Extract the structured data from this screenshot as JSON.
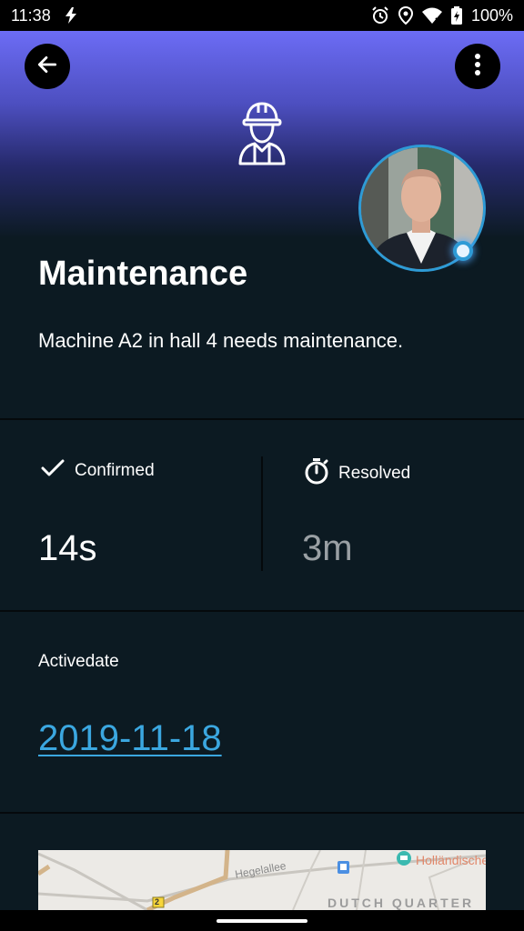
{
  "status_bar": {
    "time": "11:38",
    "battery": "100%",
    "icons": [
      "flash-icon",
      "alarm-icon",
      "location-icon",
      "wifi-icon",
      "battery-icon"
    ]
  },
  "header": {
    "back_icon": "arrow-left-icon",
    "menu_icon": "more-vert-icon",
    "category_icon": "construction-worker-icon",
    "avatar_status": "online"
  },
  "ticket": {
    "title": "Maintenance",
    "description": "Machine A2 in hall 4 needs maintenance."
  },
  "stats": {
    "confirmed": {
      "label": "Confirmed",
      "value": "14s",
      "icon": "checkmark-icon"
    },
    "resolved": {
      "label": "Resolved",
      "value": "3m",
      "icon": "stopwatch-icon"
    }
  },
  "active": {
    "label": "Activedate",
    "date": "2019-11-18"
  },
  "map": {
    "street": "Hegelallee",
    "poi": "Holländische",
    "district": "DUTCH QUARTER",
    "road_badge": "2"
  },
  "colors": {
    "accent": "#3ba7e0",
    "background": "#0c1a22",
    "header_top": "#6c6cf5",
    "muted_value": "#9aa0a4"
  }
}
